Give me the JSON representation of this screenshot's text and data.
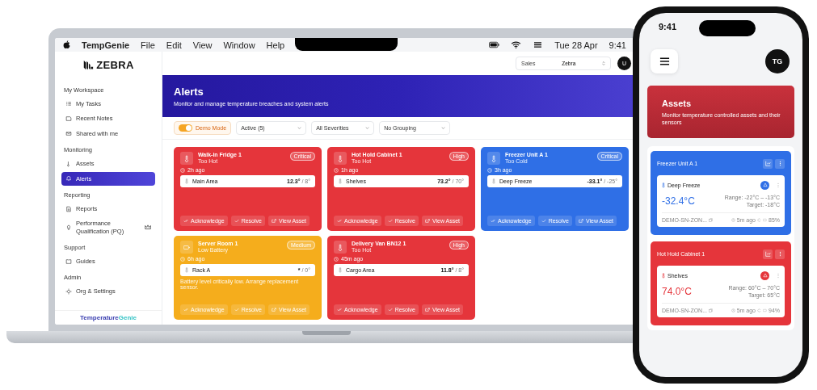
{
  "laptop": {
    "menu_bar": {
      "app": "TempGenie",
      "menus": [
        "File",
        "Edit",
        "View",
        "Window",
        "Help"
      ],
      "date": "Tue 28 Apr",
      "time": "9:41"
    },
    "sidebar": {
      "logo": "ZEBRA",
      "sections": [
        {
          "title": "My Workspace",
          "items": [
            {
              "label": "My Tasks",
              "kind": "tasks",
              "selected": false
            },
            {
              "label": "Recent Notes",
              "kind": "notes",
              "selected": false
            },
            {
              "label": "Shared with me",
              "kind": "shared",
              "selected": false
            }
          ]
        },
        {
          "title": "Monitoring",
          "items": [
            {
              "label": "Assets",
              "kind": "thermometer",
              "selected": false
            },
            {
              "label": "Alerts",
              "kind": "bell",
              "selected": true
            }
          ]
        },
        {
          "title": "Reporting",
          "items": [
            {
              "label": "Reports",
              "kind": "report",
              "selected": false
            },
            {
              "label": "Performance Qualification (PQ)",
              "kind": "bulb",
              "selected": false,
              "premium": true
            }
          ]
        },
        {
          "title": "Support",
          "items": [
            {
              "label": "Guides",
              "kind": "book",
              "selected": false
            }
          ]
        },
        {
          "title": "Admin",
          "items": [
            {
              "label": "Org & Settings",
              "kind": "gear",
              "selected": false
            }
          ]
        }
      ],
      "footer": {
        "brand_1": "Temperature",
        "brand_2": "Genie"
      }
    },
    "topbar": {
      "org_label": "Sales",
      "org": "Zebra",
      "avatar": "U"
    },
    "header": {
      "title": "Alerts",
      "subtitle": "Monitor and manage temperature breaches and system alerts"
    },
    "filters": {
      "demo_toggle": {
        "label": "Demo Mode",
        "on": true
      },
      "selects": [
        "Active (5)",
        "All Severities",
        "No Grouping"
      ]
    },
    "alerts": [
      {
        "kind": "thermometer",
        "asset": "Walk-in Fridge 1",
        "reason": "Too Hot",
        "severity": "Critical",
        "color": "#e5353b",
        "time": "2h ago",
        "zone": "Main Area",
        "reading": "12.3°",
        "target": "/ 8°",
        "actions": [
          "Acknowledge",
          "Resolve",
          "View Asset"
        ]
      },
      {
        "kind": "thermometer",
        "asset": "Hot Hold Cabinet 1",
        "reason": "Too Hot",
        "severity": "High",
        "color": "#e5353b",
        "time": "1h ago",
        "zone": "Shelves",
        "reading": "73.2°",
        "target": "/ 70°",
        "actions": [
          "Acknowledge",
          "Resolve",
          "View Asset"
        ]
      },
      {
        "kind": "thermometer",
        "asset": "Freezer Unit A 1",
        "reason": "Too Cold",
        "severity": "Critical",
        "color": "#2f6fe6",
        "time": "3h ago",
        "zone": "Deep Freeze",
        "reading": "-33.1°",
        "target": "/ -25°",
        "actions": [
          "Acknowledge",
          "Resolve",
          "View Asset"
        ]
      },
      {
        "kind": "battery",
        "asset": "Server Room 1",
        "reason": "Low Battery",
        "severity": "Medium",
        "color": "#f5ad1c",
        "time": "6h ago",
        "zone": "Rack A",
        "reading": "*",
        "target": "/ 0°",
        "note": "Battery level critically low. Arrange replacement sensor.",
        "actions": [
          "Acknowledge",
          "Resolve",
          "View Asset"
        ]
      },
      {
        "kind": "thermometer",
        "asset": "Delivery Van BN12 1",
        "reason": "Too Hot",
        "severity": "High",
        "color": "#e5353b",
        "time": "45m ago",
        "zone": "Cargo Area",
        "reading": "11.8°",
        "target": "/ 8°",
        "actions": [
          "Acknowledge",
          "Resolve",
          "View Asset"
        ]
      }
    ]
  },
  "phone": {
    "time": "9:41",
    "avatar": "TG",
    "header": {
      "title": "Assets",
      "subtitle": "Monitor temperature controlled assets and their sensors"
    },
    "assets": [
      {
        "name": "Freezer Unit A 1",
        "color": "#2f6fe6",
        "sensor": "Deep Freeze",
        "temp": "-32.4°C",
        "range": "Range: -22°C – -13°C",
        "target": "Target: -18°C",
        "device": "DEMO-SN-ZON...",
        "updated": "5m ago",
        "battery": "85%"
      },
      {
        "name": "Hot Hold Cabinet 1",
        "color": "#e5353b",
        "sensor": "Shelves",
        "temp": "74.0°C",
        "range": "Range: 60°C – 70°C",
        "target": "Target: 65°C",
        "device": "DEMO-SN-ZON...",
        "updated": "5m ago",
        "battery": "94%"
      }
    ]
  }
}
